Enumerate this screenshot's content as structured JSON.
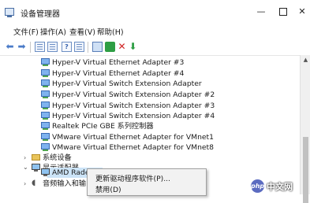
{
  "window": {
    "title": "设备管理器",
    "controls": {
      "minimize": "—",
      "maximize": "",
      "close": "✕"
    }
  },
  "menu": [
    "文件(F)",
    "操作(A)",
    "查看(V)",
    "帮助(H)"
  ],
  "toolbar": {
    "icons": [
      "back-arrow",
      "forward-arrow",
      "properties",
      "show-hide-console-tree",
      "help",
      "scan-hardware",
      "update-driver",
      "disable-device",
      "uninstall-device"
    ]
  },
  "tree": {
    "adapters": [
      "Hyper-V Virtual Ethernet Adapter #3",
      "Hyper-V Virtual Ethernet Adapter #4",
      "Hyper-V Virtual Switch Extension Adapter",
      "Hyper-V Virtual Switch Extension Adapter #2",
      "Hyper-V Virtual Switch Extension Adapter #3",
      "Hyper-V Virtual Switch Extension Adapter #4",
      "Realtek PCIe GBE 系列控制器",
      "VMware Virtual Ethernet Adapter for VMnet1",
      "VMware Virtual Ethernet Adapter for VMnet8"
    ],
    "system_devices": "系统设备",
    "display_adapters": "显示适配器",
    "display_child": "AMD Radeon HI",
    "audio": "音频输入和输出",
    "collapsed_glyph": "›",
    "expanded_glyph": "⌄"
  },
  "context_menu": {
    "items": [
      "更新驱动程序软件(P)...",
      "禁用(D)"
    ]
  },
  "watermark": {
    "logo": "php",
    "text": "中文网"
  },
  "colors": {
    "selection": "#cce4f7",
    "adapter_icon": "#7fb3ef",
    "folder": "#e9c45a"
  }
}
